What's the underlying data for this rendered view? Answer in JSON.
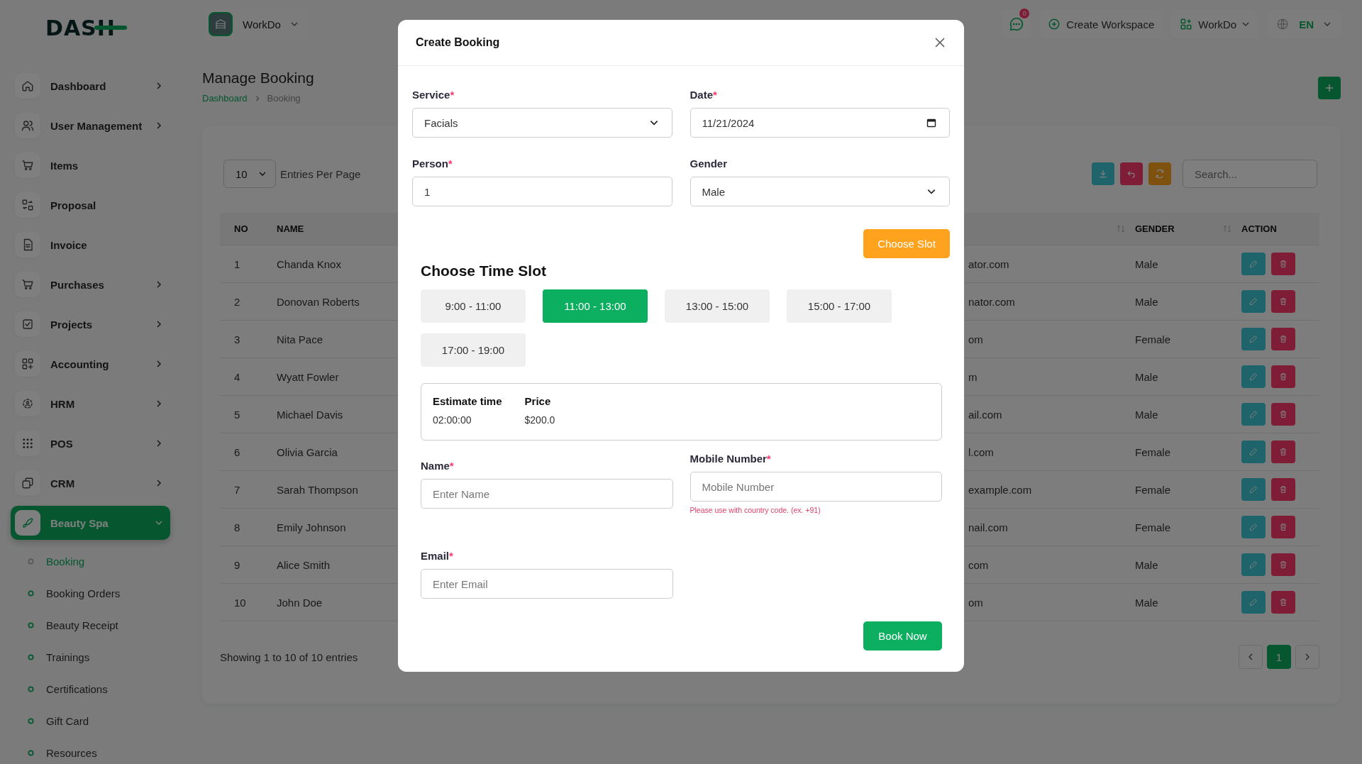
{
  "logo": "DASH",
  "workspace_switcher": {
    "label": "WorkDo"
  },
  "header": {
    "notification_count": "0",
    "create_workspace": "Create Workspace",
    "workspace_menu": "WorkDo",
    "language": "EN"
  },
  "sidebar": {
    "items": [
      {
        "label": "Dashboard",
        "has_submenu": true,
        "expanded": false,
        "selected": false
      },
      {
        "label": "User Management",
        "has_submenu": true,
        "expanded": false,
        "selected": false
      },
      {
        "label": "Items",
        "has_submenu": false,
        "selected": false
      },
      {
        "label": "Proposal",
        "has_submenu": false,
        "selected": false
      },
      {
        "label": "Invoice",
        "has_submenu": false,
        "selected": false
      },
      {
        "label": "Purchases",
        "has_submenu": true,
        "expanded": false,
        "selected": false
      },
      {
        "label": "Projects",
        "has_submenu": true,
        "expanded": false,
        "selected": false
      },
      {
        "label": "Accounting",
        "has_submenu": true,
        "expanded": false,
        "selected": false
      },
      {
        "label": "HRM",
        "has_submenu": true,
        "expanded": false,
        "selected": false
      },
      {
        "label": "POS",
        "has_submenu": true,
        "expanded": false,
        "selected": false
      },
      {
        "label": "CRM",
        "has_submenu": true,
        "expanded": false,
        "selected": false
      },
      {
        "label": "Beauty Spa",
        "has_submenu": true,
        "expanded": true,
        "selected": true,
        "children": [
          {
            "label": "Booking",
            "selected": true
          },
          {
            "label": "Booking Orders",
            "selected": false
          },
          {
            "label": "Beauty Receipt",
            "selected": false
          },
          {
            "label": "Trainings",
            "selected": false
          },
          {
            "label": "Certifications",
            "selected": false
          },
          {
            "label": "Gift Card",
            "selected": false
          },
          {
            "label": "Resources",
            "selected": false
          }
        ]
      }
    ]
  },
  "page": {
    "title": "Manage Booking",
    "breadcrumb": [
      "Dashboard",
      "Booking"
    ]
  },
  "table_controls": {
    "entries": "10",
    "entries_label": "Entries Per Page",
    "search_placeholder": "Search..."
  },
  "table": {
    "columns": [
      {
        "label": "NO",
        "sortable": false
      },
      {
        "label": "NAME",
        "sortable": false
      },
      {
        "sortable": true
      },
      {
        "label": "GENDER",
        "sortable": true
      },
      {
        "label": "ACTION",
        "sortable": false
      }
    ],
    "rows": [
      {
        "no": "1",
        "name": "Chanda Knox",
        "column_3": "ator.com",
        "gender": "Male"
      },
      {
        "no": "2",
        "name": "Donovan Roberts",
        "column_3": "nator.com",
        "gender": "Male"
      },
      {
        "no": "3",
        "name": "Nita Pace",
        "column_3": "om",
        "gender": "Female"
      },
      {
        "no": "4",
        "name": "Wyatt Fowler",
        "column_3": "m",
        "gender": "Male"
      },
      {
        "no": "5",
        "name": "Michael Davis",
        "column_3": "ail.com",
        "gender": "Male"
      },
      {
        "no": "6",
        "name": "Olivia Garcia",
        "column_3": "l.com",
        "gender": "Female"
      },
      {
        "no": "7",
        "name": "Sarah Thompson",
        "column_3": "example.com",
        "gender": "Female"
      },
      {
        "no": "8",
        "name": "Emily Johnson",
        "column_3": "nail.com",
        "gender": "Female"
      },
      {
        "no": "9",
        "name": "Alice Smith",
        "column_3": "com",
        "gender": "Male"
      },
      {
        "no": "10",
        "name": "John Doe",
        "column_3": "om",
        "gender": "Male"
      }
    ]
  },
  "table_footer": {
    "summary": "Showing 1 to 10 of 10 entries",
    "pages": [
      {
        "label": "1",
        "selected": true
      }
    ]
  },
  "modal": {
    "title": "Create Booking",
    "required_mark": "*",
    "fields": [
      {
        "label": "Service",
        "required": true,
        "kind": "select",
        "value": "Facials"
      },
      {
        "label": "Date",
        "required": true,
        "kind": "date",
        "value": "11/21/2024"
      },
      {
        "label": "Person",
        "required": true,
        "kind": "text",
        "value": "1"
      },
      {
        "label": "Gender",
        "required": false,
        "kind": "select",
        "value": "Male"
      }
    ],
    "choose_slot_button": "Choose Slot",
    "time_slot_heading": "Choose Time Slot",
    "time_slots": [
      {
        "label": "9:00 - 11:00",
        "selected": false
      },
      {
        "label": "11:00 - 13:00",
        "selected": true
      },
      {
        "label": "13:00 - 15:00",
        "selected": false
      },
      {
        "label": "15:00 - 17:00",
        "selected": false
      },
      {
        "label": "17:00 - 19:00",
        "selected": false
      }
    ],
    "estimate": [
      {
        "label": "Estimate time",
        "value": "02:00:00"
      },
      {
        "label": "Price",
        "value": "$200.0"
      }
    ],
    "contact_fields": [
      {
        "label": "Name",
        "required": true,
        "placeholder": "Enter Name"
      },
      {
        "label": "Mobile Number",
        "required": true,
        "placeholder": "Mobile Number",
        "hint": "Please use with country code. (ex. +91)"
      },
      {
        "label": "Email",
        "required": true,
        "placeholder": "Enter Email"
      }
    ],
    "submit_button": "Book Now"
  }
}
